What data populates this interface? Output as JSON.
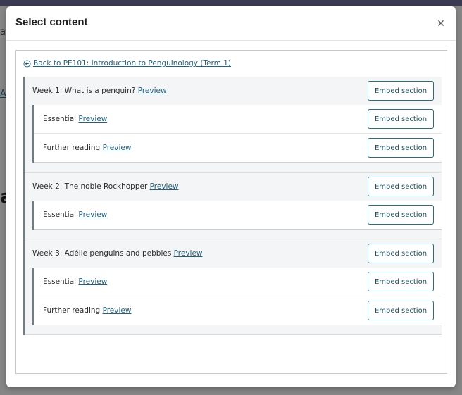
{
  "background": {
    "fragment_top": "at",
    "fragment_link": "A",
    "fragment_big": "a"
  },
  "modal": {
    "title": "Select content",
    "close_symbol": "×"
  },
  "back_link": {
    "label": " Back to PE101: Introduction to Penguinology (Term 1)"
  },
  "preview_label": "Preview",
  "embed_label": "Embed section",
  "sections": [
    {
      "label": "Week 1: What is a penguin?",
      "children": [
        {
          "label": "Essential"
        },
        {
          "label": "Further reading"
        }
      ]
    },
    {
      "label": "Week 2: The noble Rockhopper",
      "children": [
        {
          "label": "Essential"
        }
      ]
    },
    {
      "label": "Week 3: Adélie penguins and pebbles",
      "children": [
        {
          "label": "Essential"
        },
        {
          "label": "Further reading"
        }
      ]
    }
  ]
}
